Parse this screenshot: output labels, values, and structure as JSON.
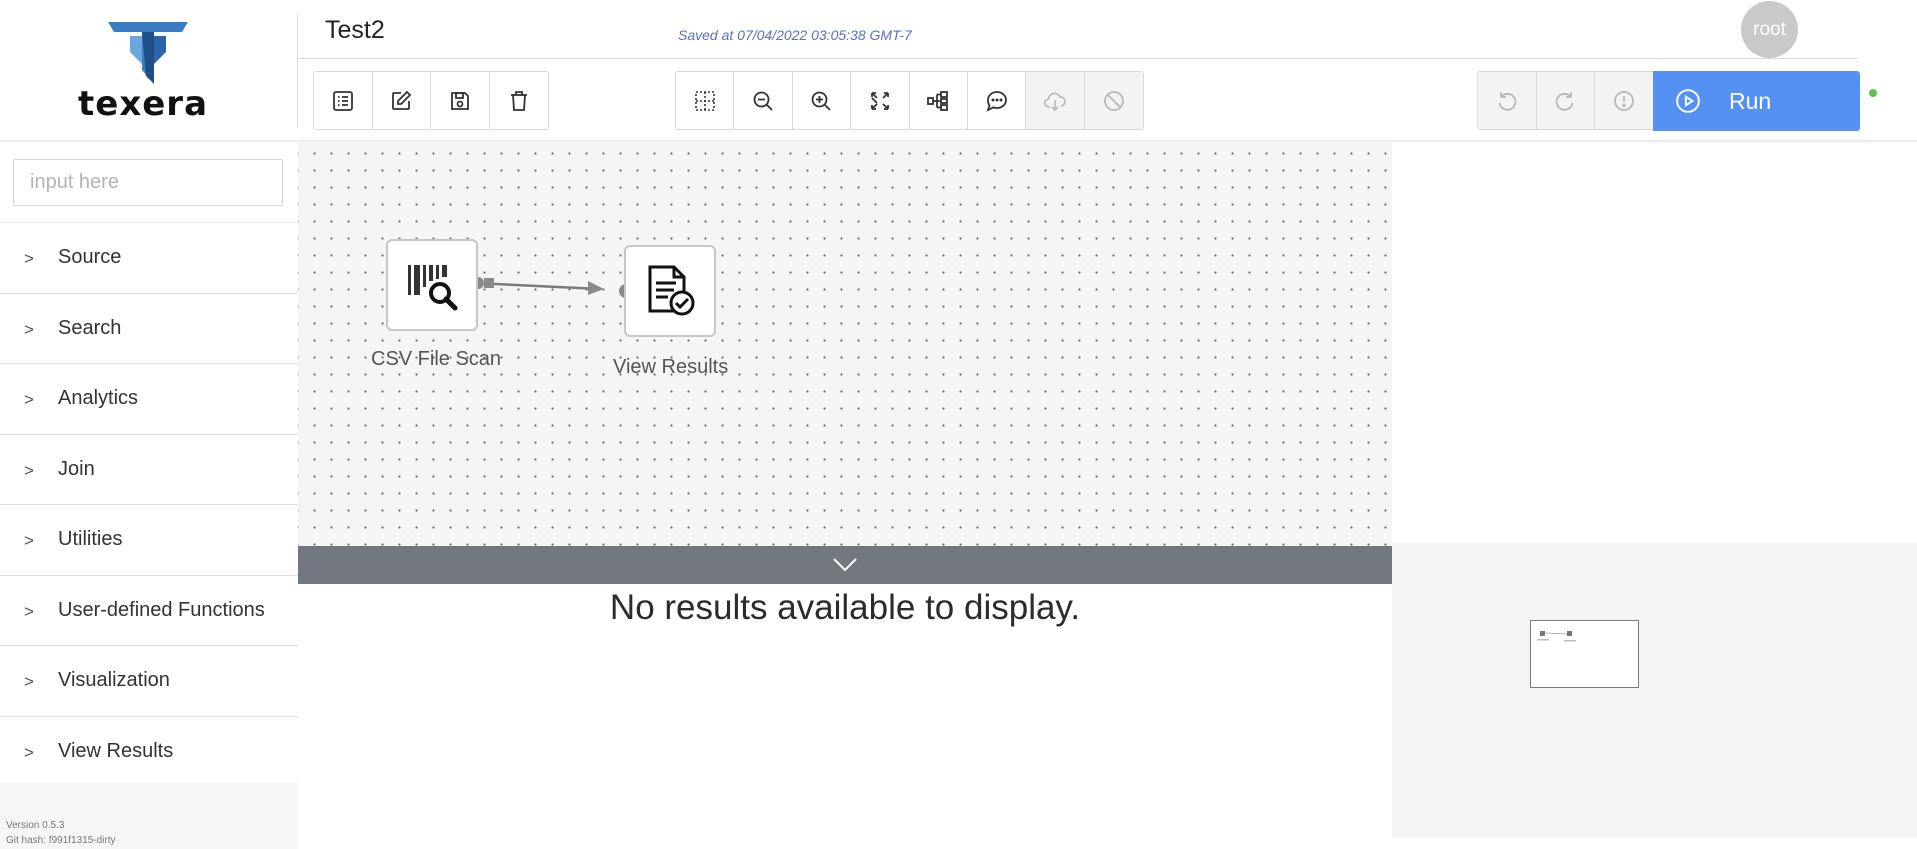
{
  "brand": {
    "name": "texera"
  },
  "header": {
    "workflow_title": "Test2",
    "save_status": "Saved at 07/04/2022 03:05:38 GMT-7",
    "user": "root"
  },
  "toolbar": {
    "edit_buttons": [
      {
        "name": "list-icon",
        "disabled": false
      },
      {
        "name": "edit-icon",
        "disabled": false
      },
      {
        "name": "save-icon",
        "disabled": false
      },
      {
        "name": "trash-icon",
        "disabled": false
      }
    ],
    "view_buttons": [
      {
        "name": "grid-icon",
        "disabled": false
      },
      {
        "name": "zoom-out-icon",
        "disabled": false
      },
      {
        "name": "zoom-in-icon",
        "disabled": false
      },
      {
        "name": "fullscreen-icon",
        "disabled": false
      },
      {
        "name": "auto-layout-icon",
        "disabled": false
      },
      {
        "name": "comment-icon",
        "disabled": false
      },
      {
        "name": "cloud-download-icon",
        "disabled": true
      },
      {
        "name": "disable-icon",
        "disabled": true
      }
    ],
    "exec_buttons": [
      {
        "name": "undo-icon",
        "disabled": true
      },
      {
        "name": "redo-icon",
        "disabled": true
      },
      {
        "name": "alert-icon",
        "disabled": true
      }
    ],
    "run_label": "Run",
    "status_color": "#5ec24b",
    "accent_color": "#5590f3"
  },
  "sidebar": {
    "search_placeholder": "input here",
    "categories": [
      "Source",
      "Search",
      "Analytics",
      "Join",
      "Utilities",
      "User-defined Functions",
      "Visualization",
      "View Results"
    ],
    "version": "Version 0.5.3",
    "git_hash": "Git hash: f991f1315-dirty"
  },
  "canvas": {
    "operators": [
      {
        "label": "CSV File Scan",
        "icon": "barcode-search-icon"
      },
      {
        "label": "View Results",
        "icon": "document-check-icon"
      }
    ]
  },
  "result_panel": {
    "message": "No results available to display."
  }
}
